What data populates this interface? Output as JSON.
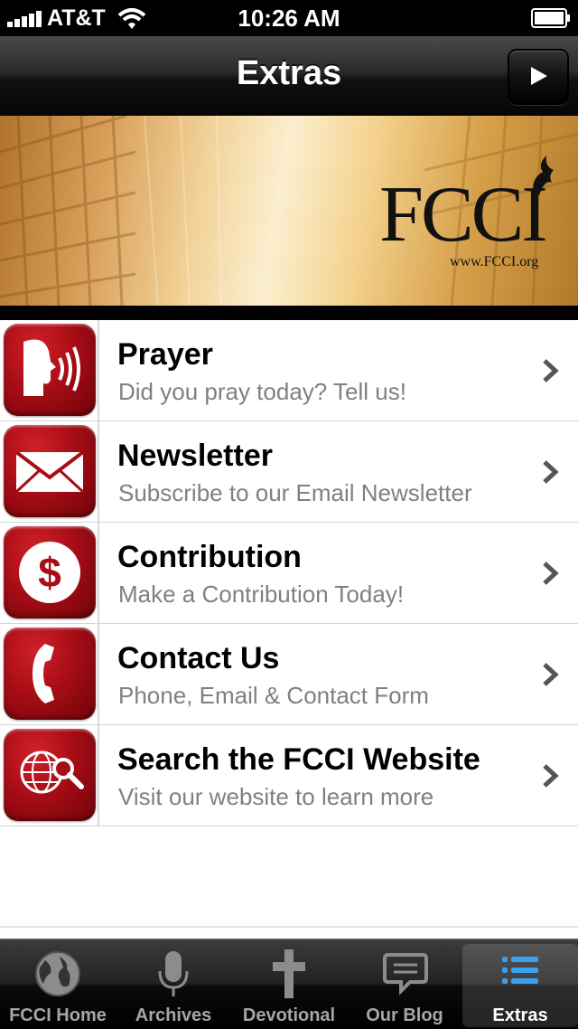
{
  "status_bar": {
    "carrier": "AT&T",
    "time": "10:26 AM"
  },
  "nav_bar": {
    "title": "Extras",
    "play_icon": "play-icon"
  },
  "banner": {
    "logo_text": "FCCI",
    "url": "www.FCCI.org"
  },
  "menu": {
    "items": [
      {
        "title": "Prayer",
        "subtitle": "Did you pray today? Tell us!",
        "icon": "speaking-head-icon"
      },
      {
        "title": "Newsletter",
        "subtitle": "Subscribe to our Email Newsletter",
        "icon": "envelope-icon"
      },
      {
        "title": "Contribution",
        "subtitle": "Make a Contribution Today!",
        "icon": "dollar-icon"
      },
      {
        "title": "Contact Us",
        "subtitle": "Phone, Email & Contact Form",
        "icon": "phone-icon"
      },
      {
        "title": "Search the FCCI Website",
        "subtitle": "Visit our website to learn more",
        "icon": "globe-search-icon"
      }
    ]
  },
  "tab_bar": {
    "tabs": [
      {
        "label": "FCCI Home",
        "icon": "globe-icon",
        "active": false
      },
      {
        "label": "Archives",
        "icon": "microphone-icon",
        "active": false
      },
      {
        "label": "Devotional",
        "icon": "cross-icon",
        "active": false
      },
      {
        "label": "Our Blog",
        "icon": "speech-bubble-icon",
        "active": false
      },
      {
        "label": "Extras",
        "icon": "list-icon",
        "active": true
      }
    ]
  },
  "colors": {
    "icon_red": "#a80d16",
    "active_tab_icon": "#3aa0f0",
    "subtitle_gray": "#808080"
  }
}
